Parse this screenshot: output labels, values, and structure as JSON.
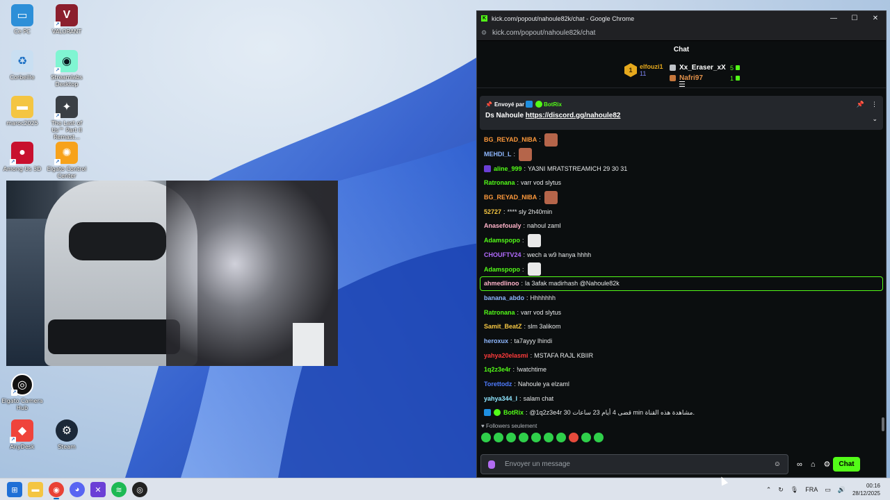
{
  "desktop": {
    "icons": [
      {
        "label": "Ce PC",
        "color": "#2d8fd8",
        "glyph": "▭"
      },
      {
        "label": "VALORANT",
        "color": "#8b1e2d",
        "glyph": "V"
      },
      {
        "label": "Corbeille",
        "color": "#c9dff2",
        "glyph": "♻"
      },
      {
        "label": "Streamlabs Desktop",
        "color": "#80f5d2",
        "glyph": "◉"
      },
      {
        "label": "maroc2025",
        "color": "#f4c542",
        "glyph": "▬"
      },
      {
        "label": "The Last of Us™ Part II Remast...",
        "color": "#3a3f45",
        "glyph": "✦"
      },
      {
        "label": "Among Us 3D",
        "color": "#c8102e",
        "glyph": "●"
      },
      {
        "label": "Elgato Control Center",
        "color": "#f7a21b",
        "glyph": "✺"
      },
      {
        "label": "Elgato Camera Hub",
        "color": "#111111",
        "glyph": "◎"
      },
      {
        "label": "AnyDesk",
        "color": "#ef443b",
        "glyph": "◆"
      },
      {
        "label": "Steam",
        "color": "#1b2838",
        "glyph": "⚙"
      }
    ]
  },
  "browser": {
    "window_title": "kick.com/popout/nahoule82k/chat - Google Chrome",
    "url": "kick.com/popout/nahoule82k/chat",
    "minimize": "—",
    "maximize": "☐",
    "close": "✕"
  },
  "chat": {
    "header": "Chat",
    "leaderboard": {
      "first": {
        "rank": "1",
        "name": "elfouzi1",
        "count": "11"
      },
      "rows": [
        {
          "name": "Xx_Eraser_xX",
          "count": "5",
          "color": "#ffffff",
          "badge": "#bfc3c8"
        },
        {
          "name": "Nafri97",
          "count": "1",
          "color": "#e3924b",
          "badge": "#c5773c"
        }
      ]
    },
    "pinned": {
      "label": "Envoyé par",
      "author": "BotRix",
      "text_prefix": "Ds Nahoule",
      "link": "https://discord.gg/nahoule82"
    },
    "messages": [
      {
        "user": "BG_REYAD_NIBA",
        "color": "#ff9a3c",
        "text": "",
        "emote": true
      },
      {
        "user": "MEHDI_L",
        "color": "#8fb8ff",
        "text": "",
        "emote": true
      },
      {
        "user": "aline_999",
        "color": "#53fc18",
        "text": "YA3NI MRATSTREAMICH 29 30 31",
        "emote": false,
        "icon": true
      },
      {
        "user": "Ratronana",
        "color": "#53fc18",
        "text": "varr vod slytus",
        "emote": false
      },
      {
        "user": "BG_REYAD_NIBA",
        "color": "#ff9a3c",
        "text": "",
        "emote": true
      },
      {
        "user": "52727",
        "color": "#f7c843",
        "text": "**** sly 2h40min",
        "emote": false
      },
      {
        "user": "Anasefoualy",
        "color": "#ffb3c9",
        "text": "nahoul zaml",
        "emote": false
      },
      {
        "user": "Adamspopo",
        "color": "#53fc18",
        "text": "",
        "emote": true
      },
      {
        "user": "CHOUFTV24",
        "color": "#b36bff",
        "text": "wech a w9 hanya hhhh",
        "emote": false
      },
      {
        "user": "Adamspopo",
        "color": "#53fc18",
        "text": "",
        "emote": true
      },
      {
        "user": "ahmedlinoo",
        "color": "#ffb3c9",
        "text": "la 3afak madirhash @Nahoule82k",
        "emote": false,
        "highlight": true
      },
      {
        "user": "banana_abdo",
        "color": "#8fb8ff",
        "text": "Hhhhhhh",
        "emote": false
      },
      {
        "user": "Ratronana",
        "color": "#53fc18",
        "text": "varr vod slytus",
        "emote": false
      },
      {
        "user": "Samit_BeatZ",
        "color": "#f7c843",
        "text": "slm 3alikom",
        "emote": false
      },
      {
        "user": "heroxux",
        "color": "#8fb8ff",
        "text": "ta7ayyy lhindi",
        "emote": false
      },
      {
        "user": "yahya20elasmi",
        "color": "#ff3b3b",
        "text": "MSTAFA RAJL KBIIR",
        "emote": false
      },
      {
        "user": "1q2z3e4r",
        "color": "#53fc18",
        "text": "!watchtime",
        "emote": false
      },
      {
        "user": "Torettodz",
        "color": "#4f7cff",
        "text": "Nahoule ya elzaml",
        "emote": false
      },
      {
        "user": "yahya344_l",
        "color": "#8fe6ff",
        "text": "salam chat",
        "emote": false
      },
      {
        "user": "BotRix",
        "color": "#53fc18",
        "text": "@1q2z3e4r 30 قضى 4 أيام 23 ساعات min مشاهدة هذه القناة.",
        "emote": false,
        "bot": true
      }
    ],
    "followers_only": "Followers seulement",
    "input_placeholder": "Envoyer un message",
    "send_label": "Chat"
  },
  "taskbar": {
    "language": "FRA",
    "time": "00:16",
    "date": "28/12/2025"
  }
}
